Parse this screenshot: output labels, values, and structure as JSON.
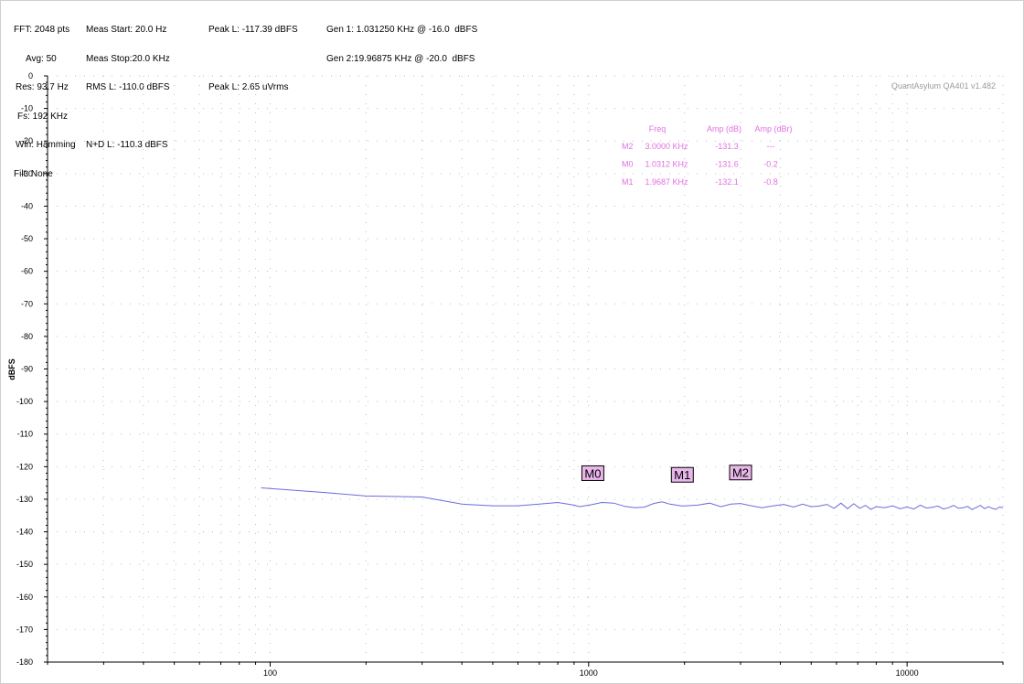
{
  "info": {
    "fft": "FFT: 2048 pts",
    "avg": "Avg: 50",
    "res": "Res: 93.7 Hz",
    "fs": "Fs: 192 KHz",
    "win": "Win: Hamming",
    "filt": "Filt: None",
    "meas_start": "Meas Start: 20.0 Hz",
    "meas_stop": "Meas Stop:20.0 KHz",
    "rms": "RMS L: -110.0 dBFS",
    "nd": "N+D L: -110.3 dBFS",
    "peak_dbfs": "Peak L: -117.39 dBFS",
    "peak_uv": "Peak L: 2.65 uVrms",
    "gen1": "Gen 1: 1.031250 KHz @ -16.0  dBFS",
    "gen2": "Gen 2:19.96875 KHz @ -20.0  dBFS"
  },
  "watermark": "QuantAsylum QA401 v1.482",
  "marker_table": {
    "headers": [
      "Freq",
      "Amp (dB)",
      "Amp (dBr)"
    ],
    "rows": [
      {
        "id": "M2",
        "freq": "3.0000 KHz",
        "amp_db": "-131.3",
        "amp_dbr": "---"
      },
      {
        "id": "M0",
        "freq": "1.0312 KHz",
        "amp_db": "-131.6",
        "amp_dbr": "-0.2"
      },
      {
        "id": "M1",
        "freq": "1.9687 KHz",
        "amp_db": "-132.1",
        "amp_dbr": "-0.8"
      }
    ],
    "color": "#e070e0"
  },
  "chart_data": {
    "type": "line",
    "title": "",
    "xlabel": "",
    "ylabel": "dBFS",
    "xscale": "log",
    "xlim": [
      20,
      20000
    ],
    "ylim": [
      -180,
      0
    ],
    "yticks": [
      0,
      -10,
      -20,
      -30,
      -40,
      -50,
      -60,
      -70,
      -80,
      -90,
      -100,
      -110,
      -120,
      -130,
      -140,
      -150,
      -160,
      -170,
      -180
    ],
    "ytick_labels": [
      "0",
      "-10",
      "-20",
      "-30",
      "-40",
      "-50",
      "-60",
      "-70",
      "-80",
      "-90",
      "-100",
      "-110",
      "-120",
      "-130",
      "-140",
      "-150",
      "-160",
      "-170",
      "-180"
    ],
    "xtick_labels": [
      {
        "x": 100,
        "label": "100"
      },
      {
        "x": 1000,
        "label": "1000"
      },
      {
        "x": 10000,
        "label": "10000"
      }
    ],
    "grid": true,
    "series": [
      {
        "color": "#6b6bdc",
        "x": [
          93.7,
          150,
          200,
          300,
          400,
          500,
          600,
          700,
          800,
          900,
          937,
          1031,
          1100,
          1200,
          1300,
          1400,
          1500,
          1600,
          1700,
          1800,
          1969,
          2200,
          2400,
          2600,
          2800,
          3000,
          3200,
          3500,
          3800,
          4100,
          4400,
          4700,
          5000,
          5300,
          5600,
          5900,
          6200,
          6500,
          6800,
          7100,
          7400,
          7700,
          8000,
          8500,
          9000,
          9500,
          10000,
          10500,
          11000,
          11500,
          12000,
          12500,
          13000,
          13500,
          14000,
          14500,
          15000,
          15500,
          16000,
          16500,
          17000,
          17500,
          18000,
          18500,
          19000,
          19500,
          20000
        ],
        "y": [
          -126.5,
          -128,
          -129,
          -129.3,
          -131.5,
          -132,
          -132,
          -131.5,
          -131,
          -131.8,
          -132.3,
          -131.6,
          -131,
          -131.2,
          -132.2,
          -132.6,
          -132.4,
          -131.3,
          -130.8,
          -131.5,
          -132.1,
          -131.8,
          -131.2,
          -132.3,
          -131.5,
          -131.3,
          -131.9,
          -132.6,
          -132,
          -131.6,
          -132.4,
          -131.5,
          -132.3,
          -132.1,
          -131.6,
          -132.8,
          -131.2,
          -132.9,
          -131.4,
          -132.8,
          -131.9,
          -133.1,
          -132.3,
          -132.6,
          -132,
          -132.9,
          -132.4,
          -133,
          -131.8,
          -132.7,
          -132.5,
          -132.1,
          -133,
          -132.6,
          -131.9,
          -132.8,
          -132.6,
          -132.2,
          -133.2,
          -132.5,
          -131.9,
          -132.9,
          -132.3,
          -132.8,
          -133.1,
          -132.4,
          -132.6
        ]
      }
    ],
    "markers": [
      {
        "label": "M0",
        "x": 1031,
        "box_y": -122
      },
      {
        "label": "M1",
        "x": 1969,
        "box_y": -122.5
      },
      {
        "label": "M2",
        "x": 3000,
        "box_y": -121.8
      }
    ]
  }
}
